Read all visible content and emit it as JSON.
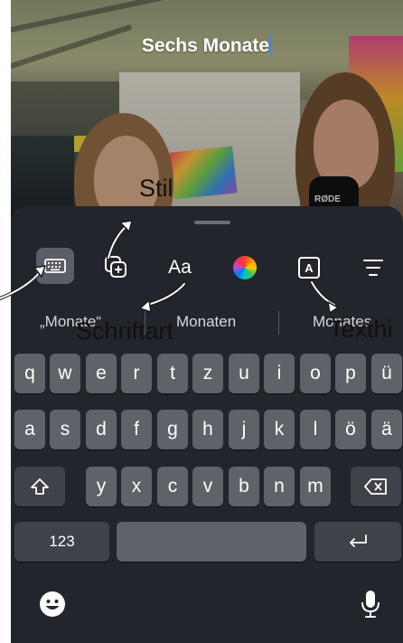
{
  "caption": {
    "text": "Sechs Monate"
  },
  "photo": {
    "mic_brand": "RØDE"
  },
  "toolbar": {
    "items": [
      {
        "name": "keyboard",
        "icon": "keyboard-icon"
      },
      {
        "name": "sticker",
        "icon": "add-sticker-icon"
      },
      {
        "name": "font",
        "label": "Aa"
      },
      {
        "name": "color",
        "icon": "color-wheel-icon"
      },
      {
        "name": "text-background",
        "label": "A"
      },
      {
        "name": "align",
        "icon": "align-lines-icon"
      }
    ]
  },
  "suggestions": [
    "„Monate“",
    "Monaten",
    "Monates"
  ],
  "keyboard": {
    "row1": [
      "q",
      "w",
      "e",
      "r",
      "t",
      "z",
      "u",
      "i",
      "o",
      "p",
      "ü"
    ],
    "row2": [
      "a",
      "s",
      "d",
      "f",
      "g",
      "h",
      "j",
      "k",
      "l",
      "ö",
      "ä"
    ],
    "row3": [
      "y",
      "x",
      "c",
      "v",
      "b",
      "n",
      "m"
    ],
    "numbers_label": "123"
  },
  "annotations": {
    "stil": "Stil",
    "schriftart": "Schriftart",
    "texthi": "Texthi"
  },
  "colors": {
    "cursor": "#3a86ff",
    "sheet": "#22252b",
    "key": "#5f6268",
    "key_dark": "#3f4248"
  }
}
